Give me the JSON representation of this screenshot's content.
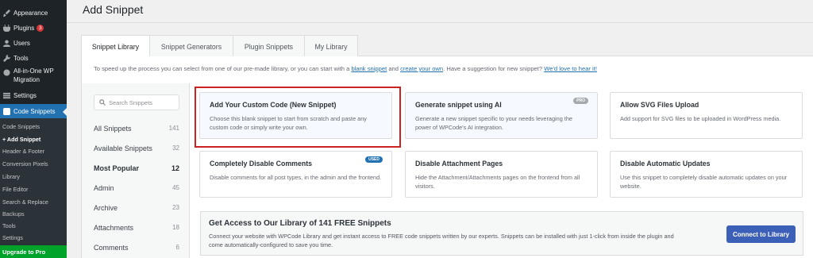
{
  "sidebar": {
    "items": [
      {
        "label": "Appearance",
        "icon": "paintbrush-icon"
      },
      {
        "label": "Plugins",
        "icon": "plugin-icon",
        "badge": "3"
      },
      {
        "label": "Users",
        "icon": "users-icon"
      },
      {
        "label": "Tools",
        "icon": "wrench-icon"
      },
      {
        "label": "All-in-One WP",
        "label2": "Migration",
        "icon": "migration-icon"
      },
      {
        "label": "Settings",
        "icon": "settings-icon"
      },
      {
        "label": "Code Snippets",
        "icon": "code-icon"
      }
    ],
    "submenu": [
      "Code Snippets",
      "+ Add Snippet",
      "Header & Footer",
      "Conversion Pixels",
      "Library",
      "File Editor",
      "Search & Replace",
      "Backups",
      "Tools",
      "Settings"
    ],
    "upgrade": "Upgrade to Pro"
  },
  "page": {
    "title": "Add Snippet"
  },
  "tabs": [
    "Snippet Library",
    "Snippet Generators",
    "Plugin Snippets",
    "My Library"
  ],
  "intro": {
    "t1": "To speed up the process you can select from one of our pre-made library, or you can start with a ",
    "link1": "blank snippet",
    "t2": " and ",
    "link2": "create your own",
    "t3": ". Have a suggestion for new snippet? ",
    "link3": "We'd love to hear it!"
  },
  "search": {
    "placeholder": "Search Snippets"
  },
  "categories": [
    {
      "label": "All Snippets",
      "count": "141"
    },
    {
      "label": "Available Snippets",
      "count": "32"
    },
    {
      "label": "Most Popular",
      "count": "12"
    },
    {
      "label": "Admin",
      "count": "45"
    },
    {
      "label": "Archive",
      "count": "23"
    },
    {
      "label": "Attachments",
      "count": "18"
    },
    {
      "label": "Comments",
      "count": "6"
    }
  ],
  "cards": [
    {
      "title": "Add Your Custom Code (New Snippet)",
      "desc": "Choose this blank snippet to start from scratch and paste any custom code or simply write your own."
    },
    {
      "title": "Generate snippet using AI",
      "desc": "Generate a new snippet specific to your needs leveraging the power of WPCode's AI integration.",
      "pill": "PRO"
    },
    {
      "title": "Allow SVG Files Upload",
      "desc": "Add support for SVG files to be uploaded in WordPress media."
    },
    {
      "title": "Completely Disable Comments",
      "desc": "Disable comments for all post types, in the admin and the frontend.",
      "pill": "USED"
    },
    {
      "title": "Disable Attachment Pages",
      "desc": "Hide the Attachment/Attachments pages on the frontend from all visitors."
    },
    {
      "title": "Disable Automatic Updates",
      "desc": "Use this snippet to completely disable automatic updates on your website."
    }
  ],
  "banner": {
    "title": "Get Access to Our Library of 141 FREE Snippets",
    "text": "Connect your website with WPCode Library and get instant access to FREE code snippets written by our experts. Snippets can be installed with just 1-click from inside the plugin and come automatically-configured to save you time.",
    "button": "Connect to Library"
  },
  "colors": {
    "accent": "#2271b1",
    "sidebar": "#1d2327",
    "highlight": "#cc2222",
    "button": "#3c5fb8",
    "upgrade": "#00a32a"
  }
}
